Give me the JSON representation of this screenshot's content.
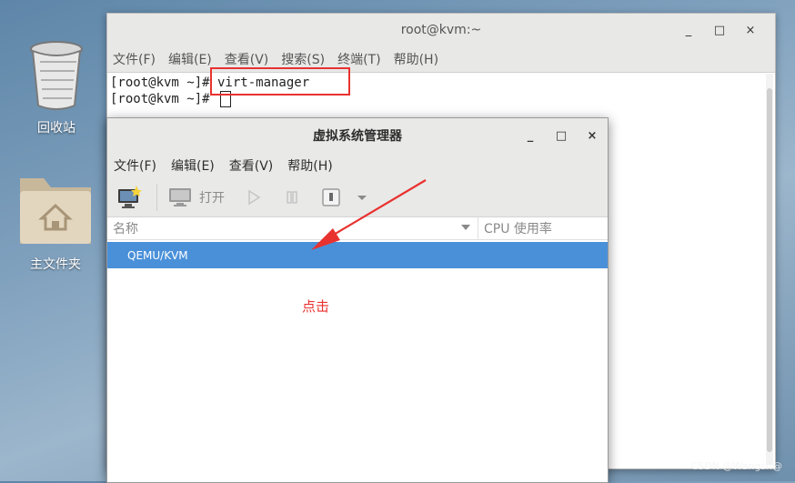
{
  "desktop": {
    "trash_label": "回收站",
    "home_label": "主文件夹"
  },
  "terminal": {
    "title": "root@kvm:~",
    "menu": [
      "文件(F)",
      "编辑(E)",
      "查看(V)",
      "搜索(S)",
      "终端(T)",
      "帮助(H)"
    ],
    "lines": [
      "[root@kvm ~]# virt-manager",
      "[root@kvm ~]# "
    ]
  },
  "window_controls": {
    "minimize": "_",
    "maximize": "□",
    "close": "×"
  },
  "vmm": {
    "title": "虚拟系统管理器",
    "menu": [
      "文件(F)",
      "编辑(E)",
      "查看(V)",
      "帮助(H)"
    ],
    "toolbar": {
      "open_label": "打开"
    },
    "columns": {
      "name": "名称",
      "cpu": "CPU 使用率"
    },
    "connections": [
      "QEMU/KVM"
    ]
  },
  "annotation": {
    "text": "点击",
    "color": "#e8322f"
  },
  "watermark": "CSDN @Wangsh@"
}
